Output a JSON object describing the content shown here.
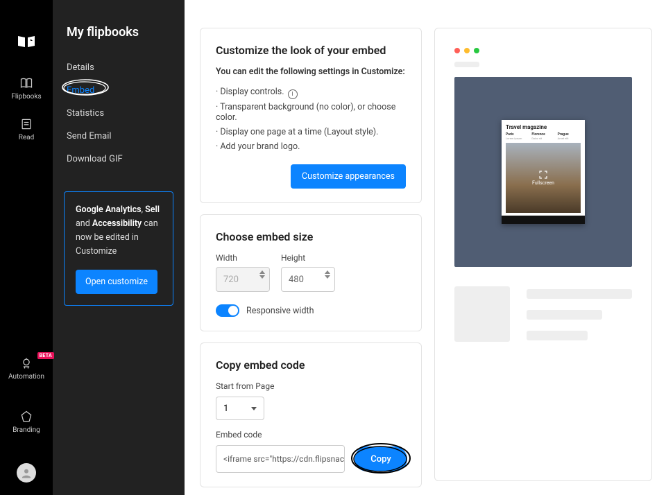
{
  "rail": {
    "items": [
      {
        "label": "Flipbooks"
      },
      {
        "label": "Read"
      }
    ],
    "bottom": [
      {
        "label": "Automation",
        "badge": "BETA"
      },
      {
        "label": "Branding"
      }
    ]
  },
  "sidebar": {
    "title": "My flipbooks",
    "items": [
      {
        "label": "Details"
      },
      {
        "label": "Embed",
        "active": true
      },
      {
        "label": "Statistics"
      },
      {
        "label": "Send Email"
      },
      {
        "label": "Download GIF"
      }
    ],
    "promo": {
      "bold1": "Google Analytics",
      "mid1": ", ",
      "bold2": "Sell",
      "mid2": " and ",
      "bold3": "Accessibility",
      "tail": " can now be edited in Customize",
      "button": "Open customize"
    }
  },
  "customize": {
    "heading": "Customize the look of your embed",
    "subheading": "You can edit the following settings in Customize:",
    "items": [
      "Display controls.",
      "Transparent background (no color), or choose color.",
      "Display one page at a time (Layout style).",
      "Add your brand logo."
    ],
    "button": "Customize appearances"
  },
  "size": {
    "heading": "Choose embed size",
    "width_label": "Width",
    "height_label": "Height",
    "width_value": "720",
    "height_value": "480",
    "responsive_label": "Responsive width"
  },
  "embed": {
    "heading": "Copy embed code",
    "start_label": "Start from Page",
    "start_value": "1",
    "code_label": "Embed code",
    "code_value": "<iframe src=\"https://cdn.flipsnack",
    "copy_button": "Copy"
  },
  "preview": {
    "mag_title": "Travel magazine",
    "cols": [
      "Paris",
      "Florence",
      "Prague"
    ],
    "fs": "Fullscreen"
  }
}
